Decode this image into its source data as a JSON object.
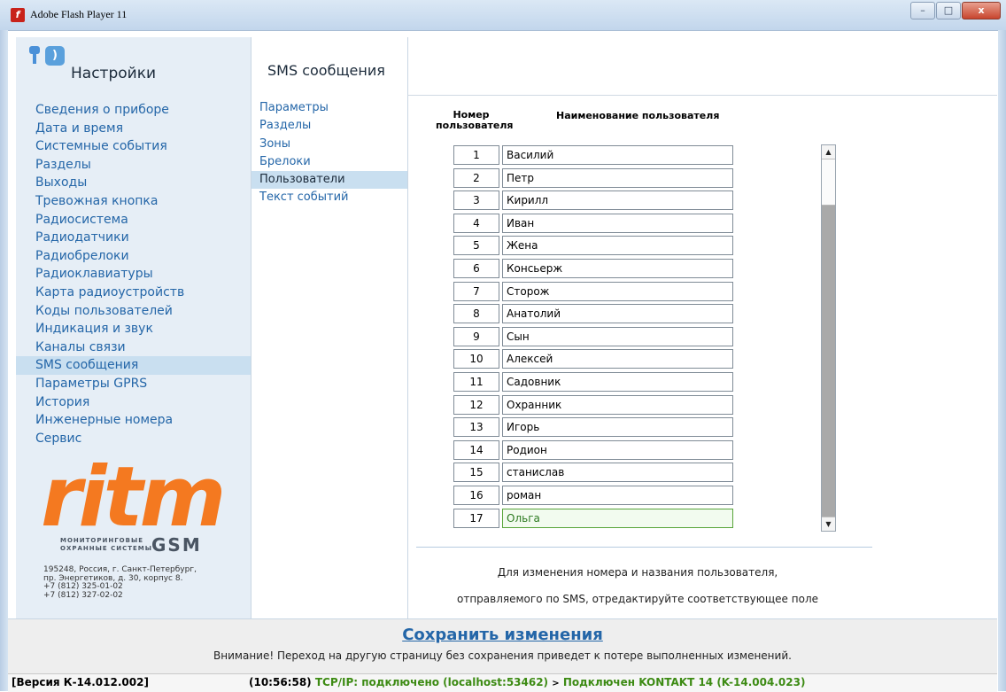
{
  "window": {
    "title": "Adobe Flash Player 11",
    "controls": [
      "–",
      "□",
      "x"
    ]
  },
  "sidebar": {
    "title": "Настройки",
    "items": [
      "Сведения о приборе",
      "Дата и время",
      "Системные события",
      "Разделы",
      "Выходы",
      "Тревожная кнопка",
      "Радиосистема",
      "Радиодатчики",
      "Радиобрелоки",
      "Радиоклавиатуры",
      "Карта радиоустройств",
      "Коды пользователей",
      "Индикация и звук",
      "Каналы связи",
      "SMS сообщения",
      "Параметры GPRS",
      "История",
      "Инженерные номера",
      "Сервис"
    ],
    "active_index": 14,
    "logo": {
      "word": "ritm",
      "line1": "МОНИТОРИНГОВЫЕ",
      "line2": "ОХРАННЫЕ СИСТЕМЫ",
      "brand": "GSM"
    },
    "address": "195248, Россия, г. Санкт-Петербург,\nпр. Энергетиков, д. 30, корпус 8.\n+7 (812) 325-01-02\n+7 (812) 327-02-02"
  },
  "submenu": {
    "title": "SMS сообщения",
    "items": [
      "Параметры",
      "Разделы",
      "Зоны",
      "Брелоки",
      "Пользователи",
      "Текст событий"
    ],
    "active_index": 4
  },
  "table": {
    "col_number": "Номер пользователя",
    "col_name": "Наименование пользователя",
    "rows": [
      {
        "num": "1",
        "name": "Василий"
      },
      {
        "num": "2",
        "name": "Петр"
      },
      {
        "num": "3",
        "name": "Кирилл"
      },
      {
        "num": "4",
        "name": "Иван"
      },
      {
        "num": "5",
        "name": "Жена"
      },
      {
        "num": "6",
        "name": "Консьерж"
      },
      {
        "num": "7",
        "name": "Сторож"
      },
      {
        "num": "8",
        "name": "Анатолий"
      },
      {
        "num": "9",
        "name": "Сын"
      },
      {
        "num": "10",
        "name": "Алексей"
      },
      {
        "num": "11",
        "name": "Садовник"
      },
      {
        "num": "12",
        "name": "Охранник"
      },
      {
        "num": "13",
        "name": "Игорь"
      },
      {
        "num": "14",
        "name": "Родион"
      },
      {
        "num": "15",
        "name": "станислав"
      },
      {
        "num": "16",
        "name": "роман"
      },
      {
        "num": "17",
        "name": "Ольга"
      }
    ],
    "focused_index": 16
  },
  "hint": {
    "line1": "Для изменения номера и названия пользователя,",
    "line2": "отправляемого по SMS, отредактируйте соответствующее поле"
  },
  "footer": {
    "save_label": "Сохранить изменения",
    "warning": "Внимание! Переход на другую страницу без сохранения приведет к потере выполненных изменений."
  },
  "status": {
    "version": "[Версия К-14.012.002]",
    "time": "(10:56:58)",
    "connection": "TCP/IP: подключено (localhost:53462)",
    "arrow": ">",
    "device": "Подключен KONTAKT 14 (K-14.004.023)"
  }
}
